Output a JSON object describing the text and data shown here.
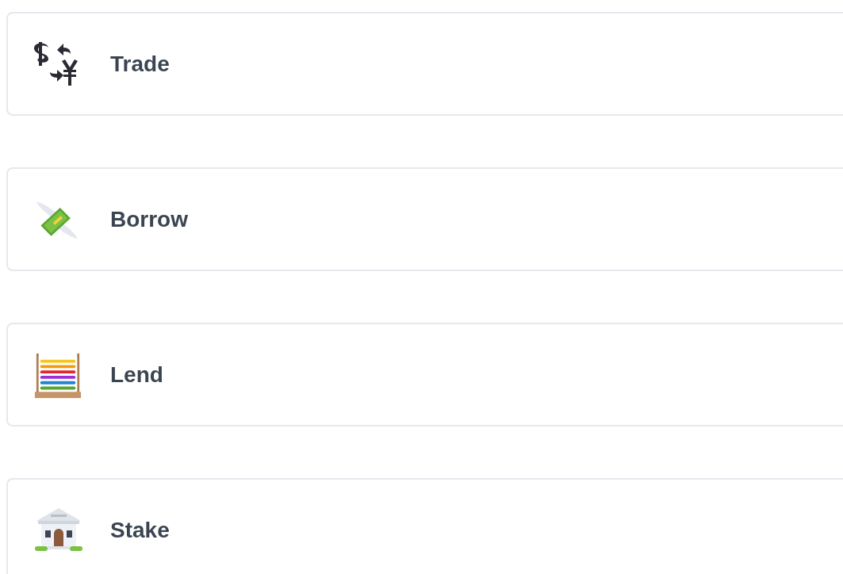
{
  "options": [
    {
      "kind": "trade",
      "label": "Trade"
    },
    {
      "kind": "borrow",
      "label": "Borrow"
    },
    {
      "kind": "lend",
      "label": "Lend"
    },
    {
      "kind": "stake",
      "label": "Stake"
    }
  ]
}
